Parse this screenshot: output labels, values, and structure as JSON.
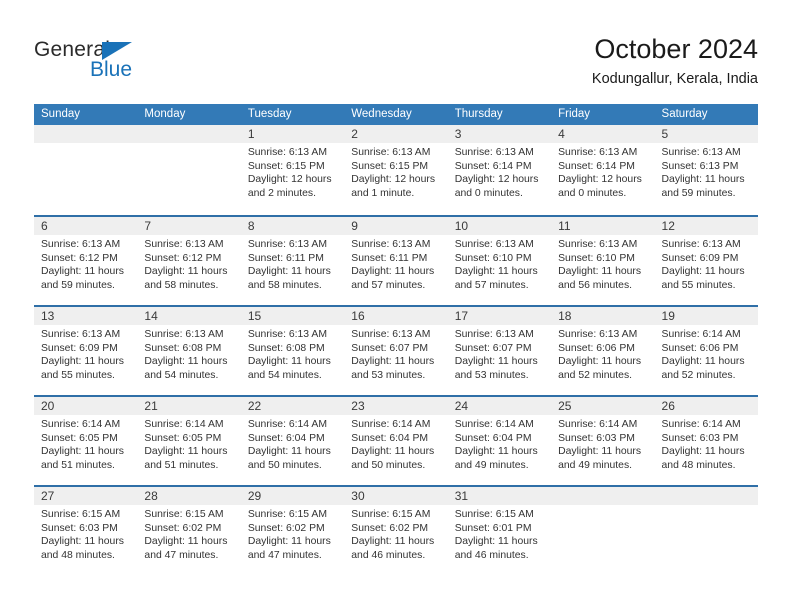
{
  "brand": {
    "name_part1": "General",
    "name_part2": "Blue",
    "triangle_icon": "triangle-icon",
    "accent_color": "#1a72b8"
  },
  "header": {
    "title": "October 2024",
    "subtitle": "Kodungallur, Kerala, India"
  },
  "colors": {
    "header_blue": "#337ab7",
    "week_divider": "#2f6fa7",
    "daynum_band": "#efefef",
    "text": "#333333"
  },
  "calendar": {
    "day_names": [
      "Sunday",
      "Monday",
      "Tuesday",
      "Wednesday",
      "Thursday",
      "Friday",
      "Saturday"
    ],
    "weeks": [
      [
        {
          "day": "",
          "lines": []
        },
        {
          "day": "",
          "lines": []
        },
        {
          "day": "1",
          "lines": [
            "Sunrise: 6:13 AM",
            "Sunset: 6:15 PM",
            "Daylight: 12 hours",
            "and 2 minutes."
          ]
        },
        {
          "day": "2",
          "lines": [
            "Sunrise: 6:13 AM",
            "Sunset: 6:15 PM",
            "Daylight: 12 hours",
            "and 1 minute."
          ]
        },
        {
          "day": "3",
          "lines": [
            "Sunrise: 6:13 AM",
            "Sunset: 6:14 PM",
            "Daylight: 12 hours",
            "and 0 minutes."
          ]
        },
        {
          "day": "4",
          "lines": [
            "Sunrise: 6:13 AM",
            "Sunset: 6:14 PM",
            "Daylight: 12 hours",
            "and 0 minutes."
          ]
        },
        {
          "day": "5",
          "lines": [
            "Sunrise: 6:13 AM",
            "Sunset: 6:13 PM",
            "Daylight: 11 hours",
            "and 59 minutes."
          ]
        }
      ],
      [
        {
          "day": "6",
          "lines": [
            "Sunrise: 6:13 AM",
            "Sunset: 6:12 PM",
            "Daylight: 11 hours",
            "and 59 minutes."
          ]
        },
        {
          "day": "7",
          "lines": [
            "Sunrise: 6:13 AM",
            "Sunset: 6:12 PM",
            "Daylight: 11 hours",
            "and 58 minutes."
          ]
        },
        {
          "day": "8",
          "lines": [
            "Sunrise: 6:13 AM",
            "Sunset: 6:11 PM",
            "Daylight: 11 hours",
            "and 58 minutes."
          ]
        },
        {
          "day": "9",
          "lines": [
            "Sunrise: 6:13 AM",
            "Sunset: 6:11 PM",
            "Daylight: 11 hours",
            "and 57 minutes."
          ]
        },
        {
          "day": "10",
          "lines": [
            "Sunrise: 6:13 AM",
            "Sunset: 6:10 PM",
            "Daylight: 11 hours",
            "and 57 minutes."
          ]
        },
        {
          "day": "11",
          "lines": [
            "Sunrise: 6:13 AM",
            "Sunset: 6:10 PM",
            "Daylight: 11 hours",
            "and 56 minutes."
          ]
        },
        {
          "day": "12",
          "lines": [
            "Sunrise: 6:13 AM",
            "Sunset: 6:09 PM",
            "Daylight: 11 hours",
            "and 55 minutes."
          ]
        }
      ],
      [
        {
          "day": "13",
          "lines": [
            "Sunrise: 6:13 AM",
            "Sunset: 6:09 PM",
            "Daylight: 11 hours",
            "and 55 minutes."
          ]
        },
        {
          "day": "14",
          "lines": [
            "Sunrise: 6:13 AM",
            "Sunset: 6:08 PM",
            "Daylight: 11 hours",
            "and 54 minutes."
          ]
        },
        {
          "day": "15",
          "lines": [
            "Sunrise: 6:13 AM",
            "Sunset: 6:08 PM",
            "Daylight: 11 hours",
            "and 54 minutes."
          ]
        },
        {
          "day": "16",
          "lines": [
            "Sunrise: 6:13 AM",
            "Sunset: 6:07 PM",
            "Daylight: 11 hours",
            "and 53 minutes."
          ]
        },
        {
          "day": "17",
          "lines": [
            "Sunrise: 6:13 AM",
            "Sunset: 6:07 PM",
            "Daylight: 11 hours",
            "and 53 minutes."
          ]
        },
        {
          "day": "18",
          "lines": [
            "Sunrise: 6:13 AM",
            "Sunset: 6:06 PM",
            "Daylight: 11 hours",
            "and 52 minutes."
          ]
        },
        {
          "day": "19",
          "lines": [
            "Sunrise: 6:14 AM",
            "Sunset: 6:06 PM",
            "Daylight: 11 hours",
            "and 52 minutes."
          ]
        }
      ],
      [
        {
          "day": "20",
          "lines": [
            "Sunrise: 6:14 AM",
            "Sunset: 6:05 PM",
            "Daylight: 11 hours",
            "and 51 minutes."
          ]
        },
        {
          "day": "21",
          "lines": [
            "Sunrise: 6:14 AM",
            "Sunset: 6:05 PM",
            "Daylight: 11 hours",
            "and 51 minutes."
          ]
        },
        {
          "day": "22",
          "lines": [
            "Sunrise: 6:14 AM",
            "Sunset: 6:04 PM",
            "Daylight: 11 hours",
            "and 50 minutes."
          ]
        },
        {
          "day": "23",
          "lines": [
            "Sunrise: 6:14 AM",
            "Sunset: 6:04 PM",
            "Daylight: 11 hours",
            "and 50 minutes."
          ]
        },
        {
          "day": "24",
          "lines": [
            "Sunrise: 6:14 AM",
            "Sunset: 6:04 PM",
            "Daylight: 11 hours",
            "and 49 minutes."
          ]
        },
        {
          "day": "25",
          "lines": [
            "Sunrise: 6:14 AM",
            "Sunset: 6:03 PM",
            "Daylight: 11 hours",
            "and 49 minutes."
          ]
        },
        {
          "day": "26",
          "lines": [
            "Sunrise: 6:14 AM",
            "Sunset: 6:03 PM",
            "Daylight: 11 hours",
            "and 48 minutes."
          ]
        }
      ],
      [
        {
          "day": "27",
          "lines": [
            "Sunrise: 6:15 AM",
            "Sunset: 6:03 PM",
            "Daylight: 11 hours",
            "and 48 minutes."
          ]
        },
        {
          "day": "28",
          "lines": [
            "Sunrise: 6:15 AM",
            "Sunset: 6:02 PM",
            "Daylight: 11 hours",
            "and 47 minutes."
          ]
        },
        {
          "day": "29",
          "lines": [
            "Sunrise: 6:15 AM",
            "Sunset: 6:02 PM",
            "Daylight: 11 hours",
            "and 47 minutes."
          ]
        },
        {
          "day": "30",
          "lines": [
            "Sunrise: 6:15 AM",
            "Sunset: 6:02 PM",
            "Daylight: 11 hours",
            "and 46 minutes."
          ]
        },
        {
          "day": "31",
          "lines": [
            "Sunrise: 6:15 AM",
            "Sunset: 6:01 PM",
            "Daylight: 11 hours",
            "and 46 minutes."
          ]
        },
        {
          "day": "",
          "lines": []
        },
        {
          "day": "",
          "lines": []
        }
      ]
    ]
  }
}
